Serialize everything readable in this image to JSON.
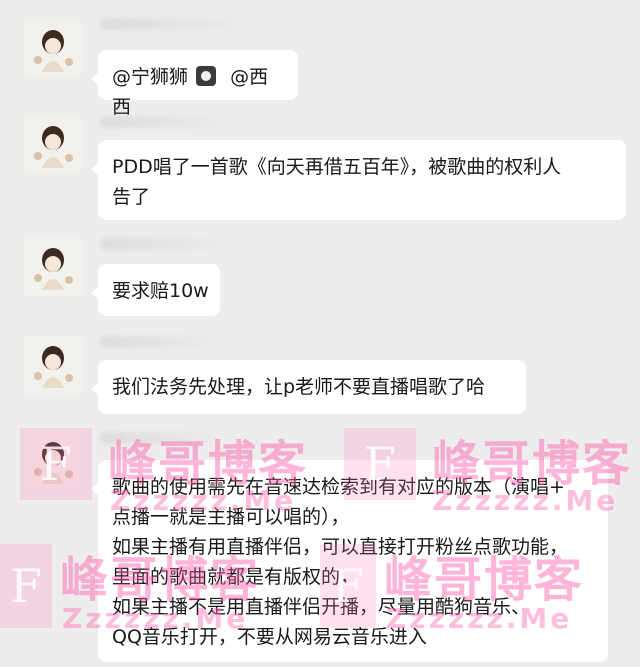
{
  "messages": [
    {
      "lines": [
        "@宁狮狮",
        "@西西"
      ]
    },
    {
      "lines": [
        "PDD唱了一首歌《向天再借五百年》，被歌曲的权利人",
        "告了"
      ]
    },
    {
      "lines": [
        "要求赔10w"
      ]
    },
    {
      "lines": [
        "我们法务先处理，让p老师不要直播唱歌了哈"
      ]
    },
    {
      "lines": [
        "歌曲的使用需先在音速达检索到有对应的版本（演唱+",
        "点播一就是主播可以唱的），",
        "如果主播有用直播伴侣，可以直接打开粉丝点歌功能，",
        "里面的歌曲就都是有版权的，",
        "如果主播不是用直播伴侣开播，尽量用酷狗音乐、",
        "QQ音乐打开，不要从网易云音乐进入"
      ]
    }
  ],
  "watermark": {
    "letter": "F",
    "title": "峰哥博客",
    "sub": "Zzzzzz.Me"
  },
  "colors": {
    "background": "#ededed",
    "bubble": "#ffffff",
    "watermark": "#ff5aaa"
  }
}
